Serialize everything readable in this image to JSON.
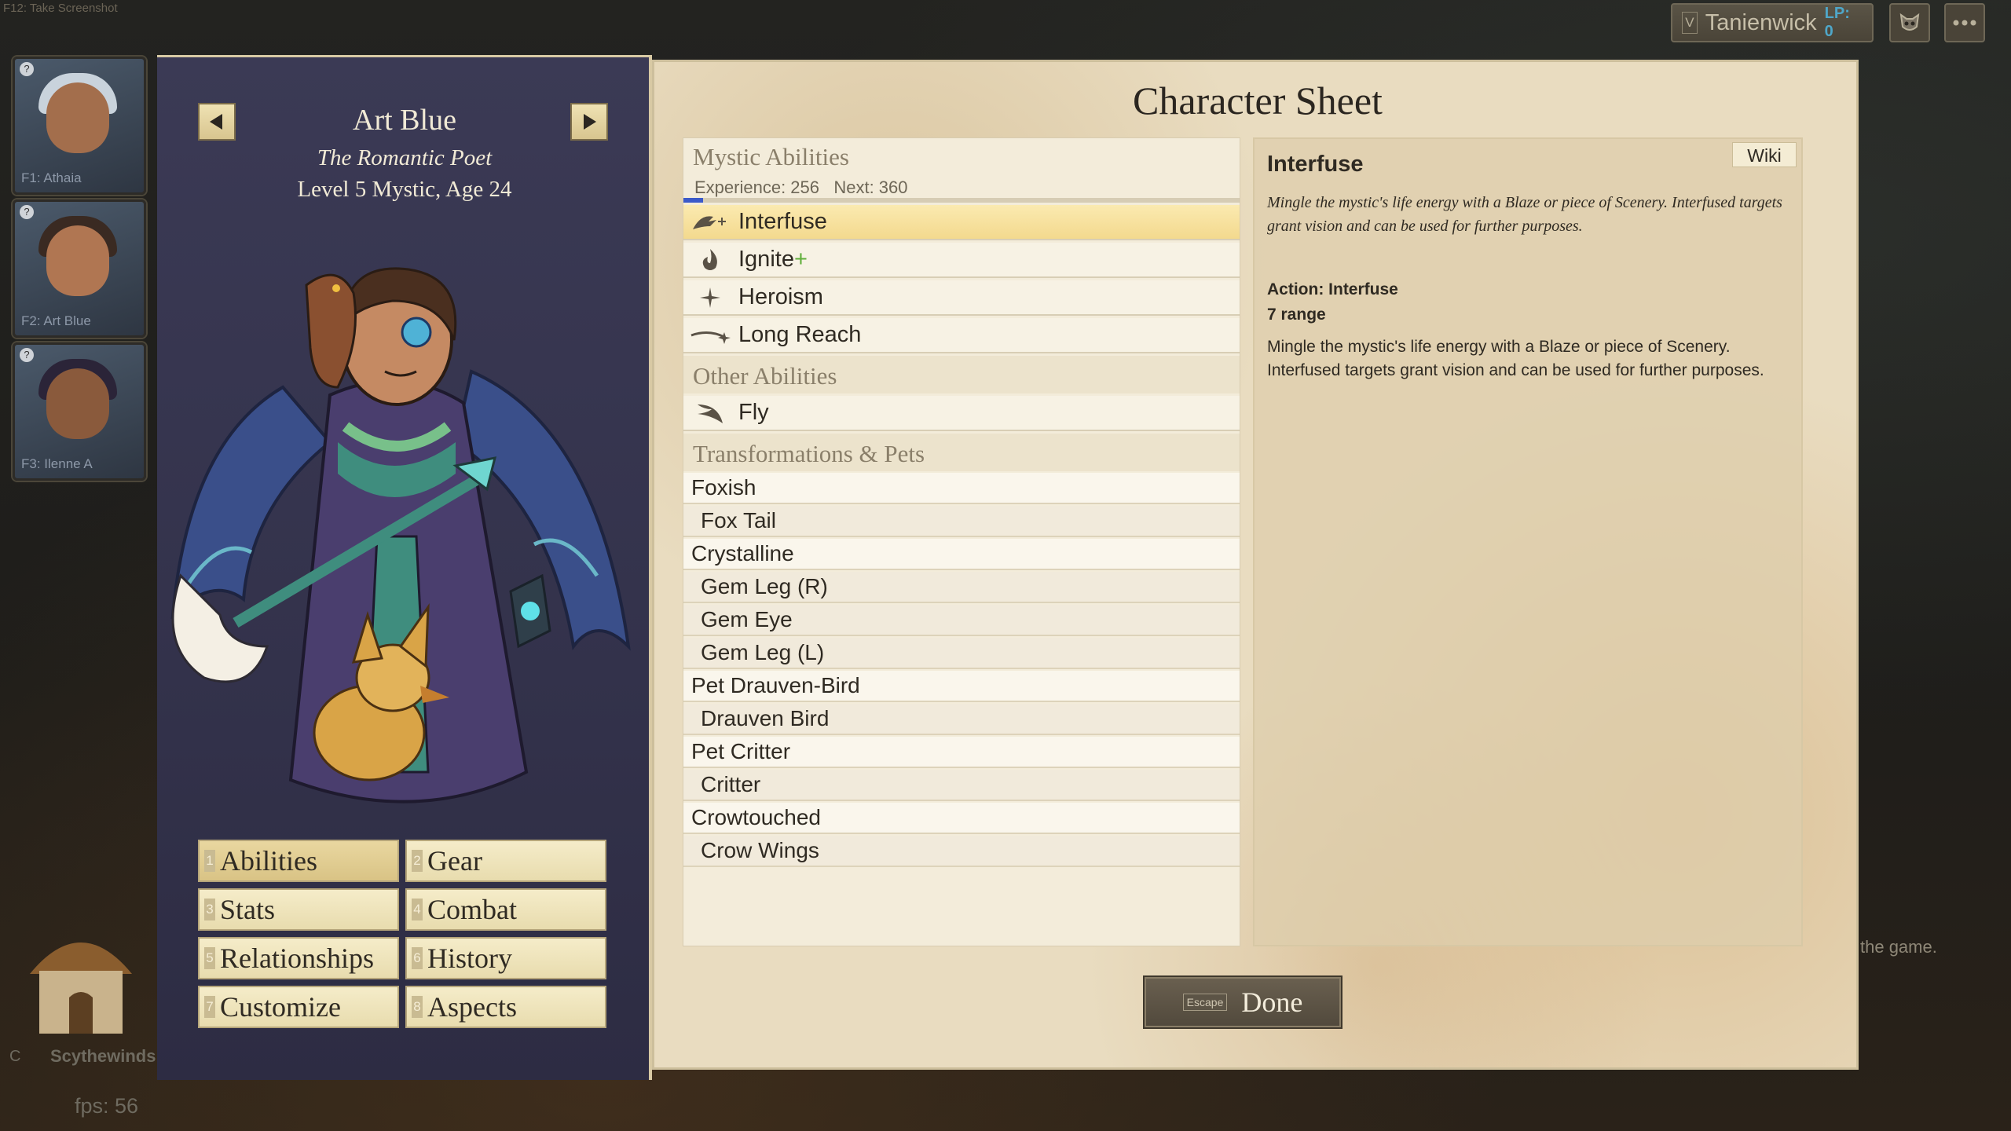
{
  "top": {
    "hint": "F12: Take Screenshot",
    "player": {
      "key": "V",
      "name": "Tanienwick",
      "lp": "LP: 0"
    },
    "icons": {
      "mask": "mask-icon",
      "menu": "more-icon"
    }
  },
  "party": [
    {
      "label": "F1: Athaia"
    },
    {
      "label": "F2: Art Blue"
    },
    {
      "label": "F3: Ilenne A"
    }
  ],
  "background": {
    "key": "C",
    "name": "Scythewinds",
    "hint": "the game.",
    "fps": "fps: 56"
  },
  "character": {
    "name": "Art Blue",
    "title": "The Romantic Poet",
    "level": "Level 5 Mystic, Age 24"
  },
  "nav": [
    {
      "num": "1",
      "label": "Abilities"
    },
    {
      "num": "2",
      "label": "Gear"
    },
    {
      "num": "3",
      "label": "Stats"
    },
    {
      "num": "4",
      "label": "Combat"
    },
    {
      "num": "5",
      "label": "Relationships"
    },
    {
      "num": "6",
      "label": "History"
    },
    {
      "num": "7",
      "label": "Customize"
    },
    {
      "num": "8",
      "label": "Aspects"
    }
  ],
  "sheet": {
    "title": "Character Sheet",
    "mystic_header": "Mystic Abilities",
    "experience": "Experience: 256",
    "next": "Next: 360",
    "xp_fraction": 0.036,
    "mystic_abilities": [
      {
        "label": "Interfuse",
        "icon": "interfuse-icon",
        "selected": true
      },
      {
        "label": "Ignite",
        "icon": "flame-icon",
        "plus": "+"
      },
      {
        "label": "Heroism",
        "icon": "sparkle-icon"
      },
      {
        "label": "Long Reach",
        "icon": "long-reach-icon"
      }
    ],
    "other_header": "Other Abilities",
    "other_abilities": [
      {
        "label": "Fly",
        "icon": "wing-icon"
      }
    ],
    "transform_header": "Transformations & Pets",
    "transforms": [
      {
        "label": "Foxish",
        "sub": false
      },
      {
        "label": "Fox Tail",
        "sub": true
      },
      {
        "label": "Crystalline",
        "sub": false
      },
      {
        "label": "Gem Leg (R)",
        "sub": true
      },
      {
        "label": "Gem Eye",
        "sub": true
      },
      {
        "label": "Gem Leg (L)",
        "sub": true
      },
      {
        "label": "Pet Drauven-Bird",
        "sub": false
      },
      {
        "label": "Drauven Bird",
        "sub": true
      },
      {
        "label": "Pet Critter",
        "sub": false
      },
      {
        "label": "Critter",
        "sub": true
      },
      {
        "label": "Crowtouched",
        "sub": false
      },
      {
        "label": "Crow Wings",
        "sub": true
      }
    ]
  },
  "detail": {
    "wiki": "Wiki",
    "title": "Interfuse",
    "flavor": "Mingle the mystic's life energy with a Blaze or piece of Scenery. Interfused targets grant vision and can be used for further purposes.",
    "action": "Action: Interfuse",
    "range": "7 range",
    "description": "Mingle the mystic's life energy with a Blaze or piece of Scenery. Interfused targets grant vision and can be used for further purposes."
  },
  "done": {
    "key": "Escape",
    "label": "Done"
  },
  "colors": {
    "selected_row": "#f3d98e",
    "xp_bar": "#3b5ac9",
    "panel_bg": "#3b3a55",
    "parchment": "#e9dcc0"
  }
}
